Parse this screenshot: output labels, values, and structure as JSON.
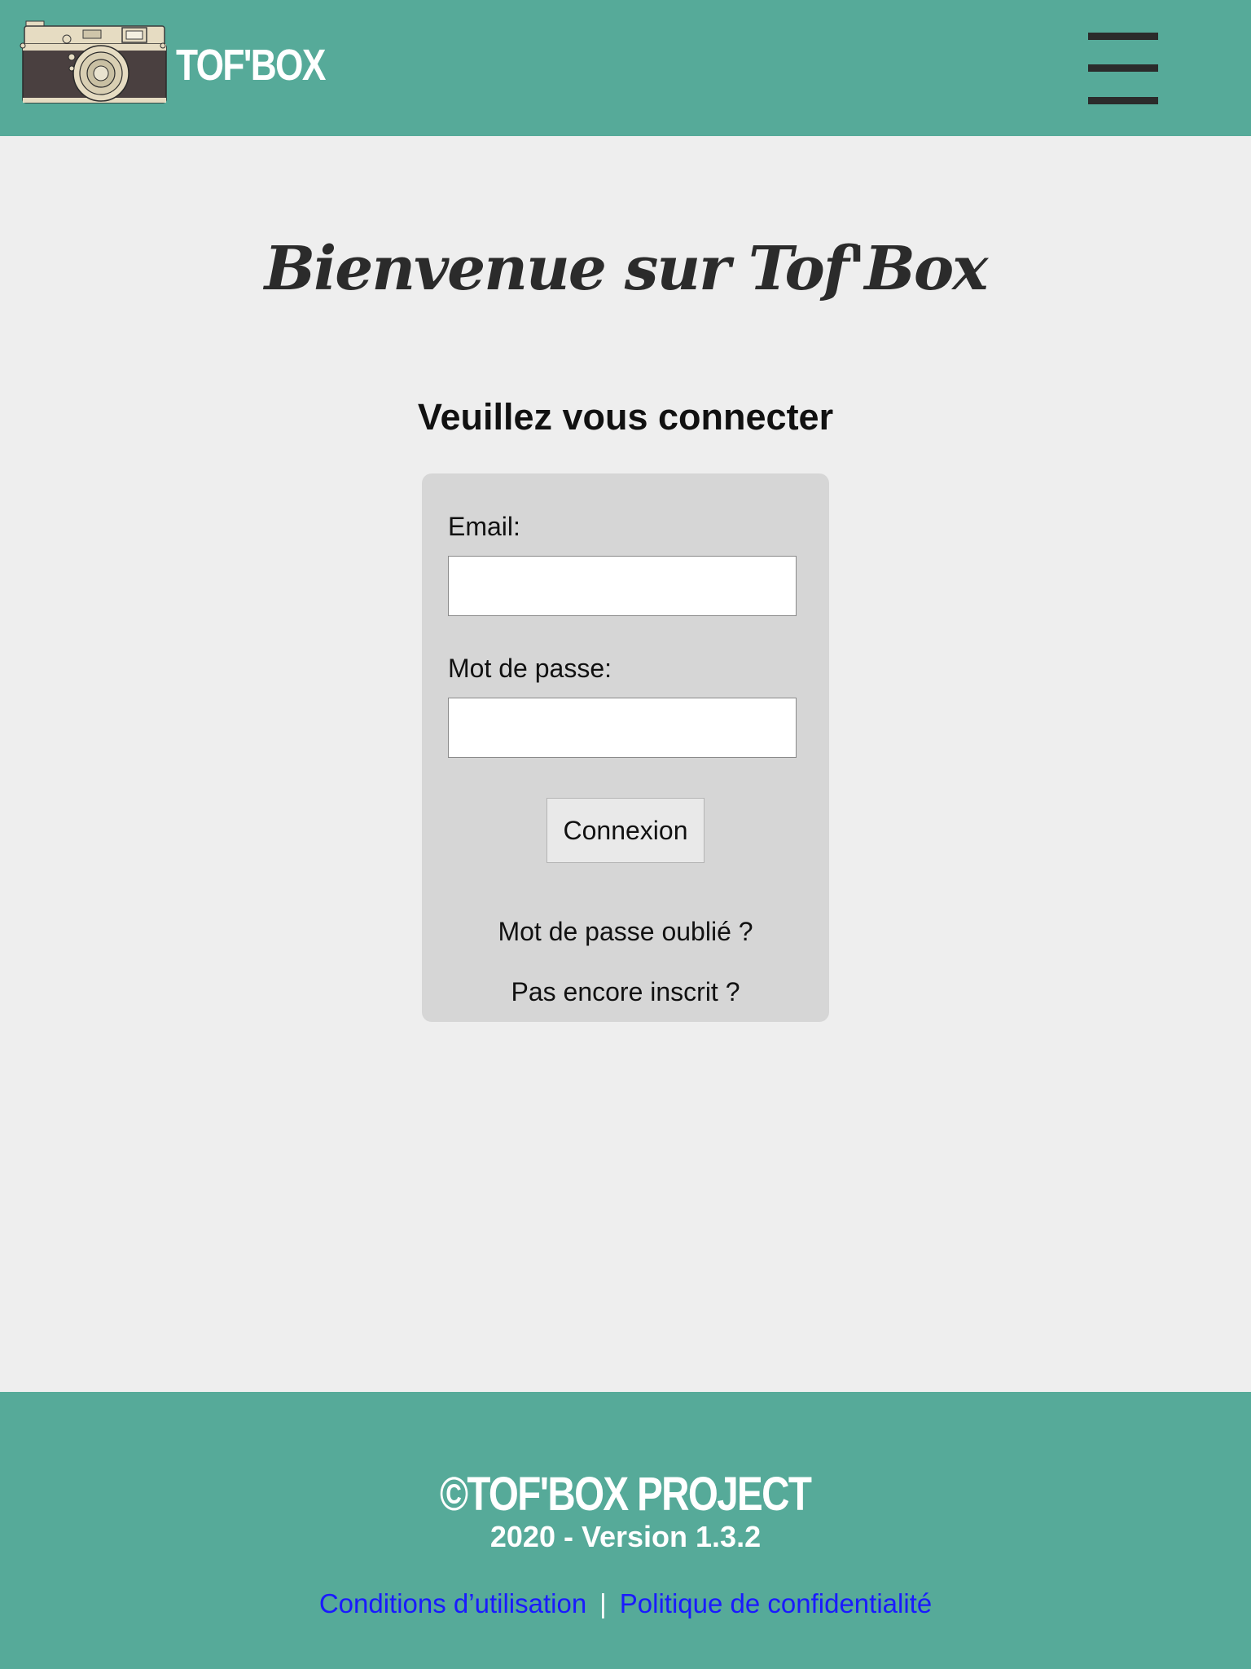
{
  "header": {
    "brand": "TOF'BOX",
    "logo_icon": "camera-icon",
    "menu_icon": "hamburger-menu-icon"
  },
  "main": {
    "welcome": "Bienvenue sur Tof'Box",
    "subtitle": "Veuillez vous connecter",
    "form": {
      "email_label": "Email:",
      "email_value": "",
      "password_label": "Mot de passe:",
      "password_value": "",
      "submit_label": "Connexion",
      "forgot_link": "Mot de passe oublié ?",
      "register_link": "Pas encore inscrit ?"
    }
  },
  "footer": {
    "brand": "©TOF'BOX PROJECT",
    "version": "2020 - Version 1.3.2",
    "links": {
      "terms": "Conditions d’utilisation",
      "separator": "|",
      "privacy": "Politique de confidentialité"
    }
  },
  "colors": {
    "header_bg": "#56aa99",
    "page_bg": "#eeeeee",
    "card_bg": "#d6d6d6",
    "link": "#1a1aff"
  }
}
